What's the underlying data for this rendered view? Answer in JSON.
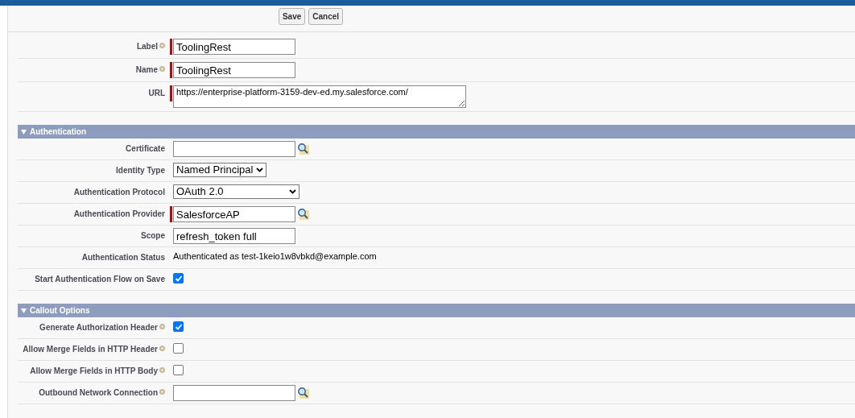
{
  "buttons": [
    "Save",
    "Cancel"
  ],
  "sections": [
    {
      "rows": [
        {
          "label": "Label",
          "help": true,
          "kind": "text",
          "required": true,
          "value": "ToolingRest"
        },
        {
          "label": "Name",
          "help": true,
          "kind": "text",
          "required": true,
          "value": "ToolingRest"
        },
        {
          "label": "URL",
          "help": false,
          "kind": "textarea",
          "required": true,
          "value": "https://enterprise-platform-3159-dev-ed.my.salesforce.com/"
        }
      ]
    },
    {
      "title": "Authentication",
      "expanded": true,
      "rows": [
        {
          "label": "Certificate",
          "help": false,
          "kind": "lookup",
          "required": false,
          "value": ""
        },
        {
          "label": "Identity Type",
          "help": false,
          "kind": "select",
          "required": false,
          "value": "Named Principal"
        },
        {
          "label": "Authentication Protocol",
          "help": false,
          "kind": "select",
          "required": false,
          "value": "OAuth 2.0"
        },
        {
          "label": "Authentication Provider",
          "help": false,
          "kind": "lookup",
          "required": true,
          "value": "SalesforceAP"
        },
        {
          "label": "Scope",
          "help": false,
          "kind": "text",
          "required": false,
          "value": "refresh_token full"
        },
        {
          "label": "Authentication Status",
          "help": false,
          "kind": "output",
          "required": false,
          "value": "Authenticated as test-1keio1w8vbkd@example.com"
        },
        {
          "label": "Start Authentication Flow on Save",
          "help": false,
          "kind": "checkbox",
          "required": false,
          "checked": true
        }
      ]
    },
    {
      "title": "Callout Options",
      "expanded": true,
      "rows": [
        {
          "label": "Generate Authorization Header",
          "help": true,
          "kind": "checkbox",
          "required": false,
          "checked": true
        },
        {
          "label": "Allow Merge Fields in HTTP Header",
          "help": true,
          "kind": "checkbox",
          "required": false,
          "checked": false
        },
        {
          "label": "Allow Merge Fields in HTTP Body",
          "help": true,
          "kind": "checkbox",
          "required": false,
          "checked": false
        },
        {
          "label": "Outbound Network Connection",
          "help": true,
          "kind": "lookup",
          "required": false,
          "value": ""
        }
      ]
    }
  ]
}
